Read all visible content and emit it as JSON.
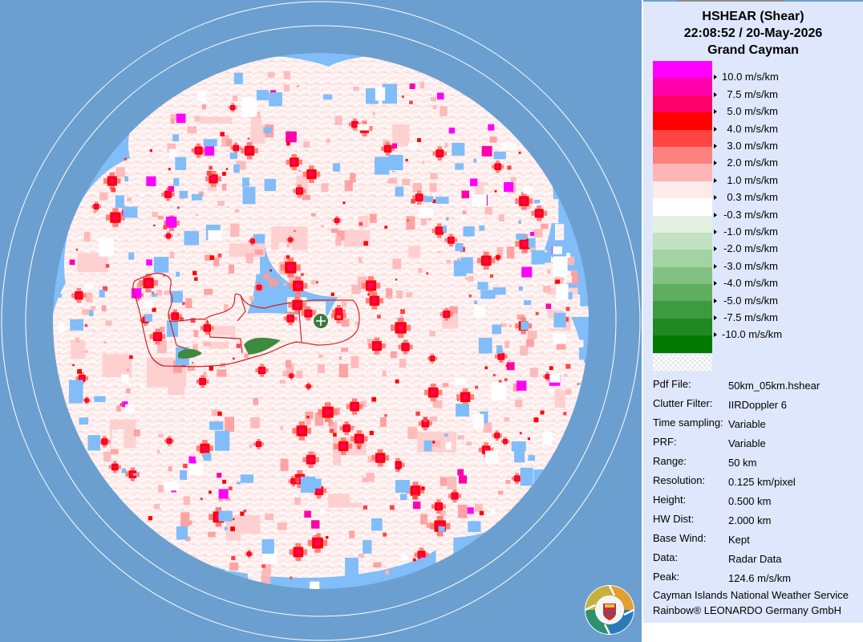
{
  "header": {
    "product": "HSHEAR (Shear)",
    "datetime": "22:08:52 / 20-May-2026",
    "site": "Grand Cayman"
  },
  "legend": {
    "items": [
      {
        "label": "10.0 m/s/km",
        "color": "#ff00ff"
      },
      {
        "label": "7.5 m/s/km",
        "color": "#ff00aa"
      },
      {
        "label": "5.0 m/s/km",
        "color": "#ff0066"
      },
      {
        "label": "4.0 m/s/km",
        "color": "#ff0000"
      },
      {
        "label": "3.0 m/s/km",
        "color": "#ff4444"
      },
      {
        "label": "2.0 m/s/km",
        "color": "#ff8080"
      },
      {
        "label": "1.0 m/s/km",
        "color": "#ffb5b5"
      },
      {
        "label": "0.3 m/s/km",
        "color": "#ffeaea"
      },
      {
        "label": "-0.3 m/s/km",
        "color": "#ffffff"
      },
      {
        "label": "-1.0 m/s/km",
        "color": "#e3f1e3"
      },
      {
        "label": "-2.0 m/s/km",
        "color": "#c3e2c3"
      },
      {
        "label": "-3.0 m/s/km",
        "color": "#a2d3a2"
      },
      {
        "label": "-4.0 m/s/km",
        "color": "#82c182"
      },
      {
        "label": "-5.0 m/s/km",
        "color": "#5fae5f"
      },
      {
        "label": "-7.5 m/s/km",
        "color": "#3e9a3e"
      },
      {
        "label": "-10.0 m/s/km",
        "color": "#1f8a1f"
      },
      {
        "label": "",
        "color": "#007a00"
      }
    ]
  },
  "info": [
    {
      "key": "Pdf File:",
      "value": "50km_05km.hshear"
    },
    {
      "key": "Clutter Filter:",
      "value": "IIRDoppler 6"
    },
    {
      "key": "Time sampling:",
      "value": "Variable"
    },
    {
      "key": "PRF:",
      "value": "Variable"
    },
    {
      "key": "Range:",
      "value": "50 km"
    },
    {
      "key": "Resolution:",
      "value": "0.125 km/pixel"
    },
    {
      "key": "Height:",
      "value": "0.500 km"
    },
    {
      "key": "HW Dist:",
      "value": "2.000 km"
    },
    {
      "key": "Base Wind:",
      "value": "Kept"
    },
    {
      "key": "Data:",
      "value": "Radar Data"
    },
    {
      "key": "Peak:",
      "value": "124.6 m/s/km"
    }
  ],
  "footer": {
    "line1": "Cayman Islands National Weather Service",
    "line2": "Rainbow® LEONARDO Germany GmbH"
  },
  "colors": {
    "background": "#6b9fcf",
    "no_echo": "#80bdf9",
    "panel": "#dfe7fc",
    "coastline": "#d42020",
    "radar_site": "#3a7a3a"
  },
  "icons": {
    "radar_site": "radar-site-icon",
    "logo": "cayman-nws-logo-icon"
  }
}
